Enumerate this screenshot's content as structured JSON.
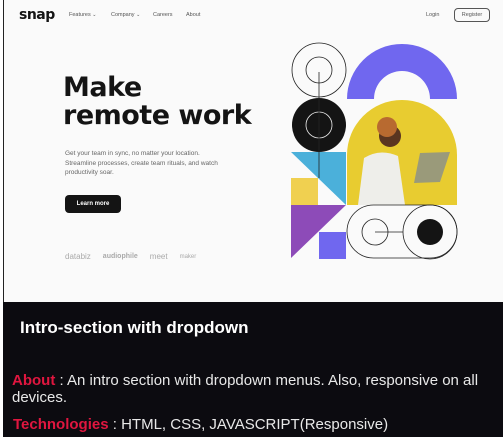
{
  "header": {
    "logo": "snap",
    "nav": [
      {
        "label": "Features",
        "chevron": "⌄"
      },
      {
        "label": "Company",
        "chevron": "⌄"
      },
      {
        "label": "Careers"
      },
      {
        "label": "About"
      }
    ],
    "login": "Login",
    "register": "Register"
  },
  "hero": {
    "title_line1": "Make",
    "title_line2": "remote work",
    "description": "Get your team in sync, no matter your location. Streamline processes, create team rituals, and watch productivity soar.",
    "cta": "Learn more",
    "clients": [
      "databiz",
      "audiophile",
      "meet",
      "maker"
    ]
  },
  "info": {
    "title": "Intro-section with dropdown",
    "about_label": "About",
    "about_text": " : An intro section with dropdown menus. Also, responsive on all devices.",
    "tech_label": "Technologies",
    "tech_text": " : HTML, CSS, JAVASCRIPT(Responsive)"
  },
  "colors": {
    "accent": "#e0163f",
    "purple": "#7067ef",
    "yellow": "#e8cc30",
    "blue": "#4bb0da",
    "violet": "#8d4bb8"
  }
}
